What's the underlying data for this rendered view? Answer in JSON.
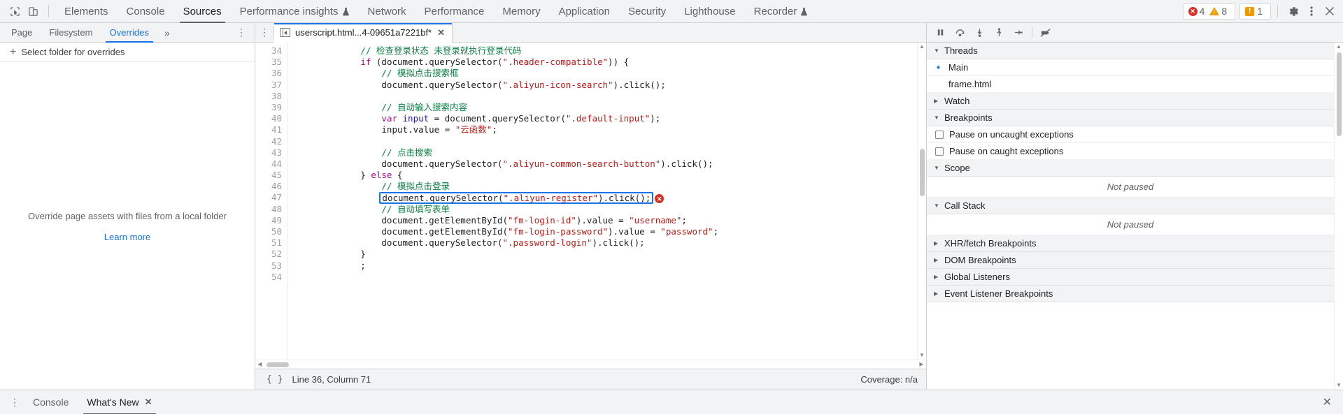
{
  "toolbar": {
    "inspect_icon": "cursor-inspect-icon",
    "device_icon": "device-toolbar-icon",
    "tabs": [
      {
        "label": "Elements",
        "active": false
      },
      {
        "label": "Console",
        "active": false
      },
      {
        "label": "Sources",
        "active": true
      },
      {
        "label": "Performance insights",
        "active": false,
        "badge": "flask-icon"
      },
      {
        "label": "Network",
        "active": false
      },
      {
        "label": "Performance",
        "active": false
      },
      {
        "label": "Memory",
        "active": false
      },
      {
        "label": "Application",
        "active": false
      },
      {
        "label": "Security",
        "active": false
      },
      {
        "label": "Lighthouse",
        "active": false
      },
      {
        "label": "Recorder",
        "active": false,
        "badge": "flask-icon"
      }
    ],
    "error_count": "4",
    "warning_count": "8",
    "issue_count": "1",
    "settings_icon": "gear-icon",
    "more_icon": "vertical-dots-icon",
    "close_icon": "close-icon"
  },
  "navigator": {
    "tabs": [
      {
        "label": "Page",
        "active": false
      },
      {
        "label": "Filesystem",
        "active": false
      },
      {
        "label": "Overrides",
        "active": true
      }
    ],
    "more_tabs": "»",
    "menu_dots": "⋮",
    "select_folder_label": "Select folder for overrides",
    "empty_message": "Override page assets with files from a local folder",
    "learn_more": "Learn more"
  },
  "editor": {
    "tab_dots": "⋮",
    "file_name": "userscript.html...4-09651a7221bf*",
    "close_label": "✕",
    "first_line_number": 34,
    "lines": [
      {
        "n": 34,
        "tokens": [
          {
            "t": "cmt",
            "s": "            // 检查登录状态 未登录就执行登录代码"
          }
        ]
      },
      {
        "n": 35,
        "tokens": [
          {
            "t": "plain",
            "s": "            "
          },
          {
            "t": "kw",
            "s": "if"
          },
          {
            "t": "plain",
            "s": " (document.querySelector("
          },
          {
            "t": "str",
            "s": "\".header-compatible\""
          },
          {
            "t": "plain",
            "s": ")) {"
          }
        ]
      },
      {
        "n": 36,
        "tokens": [
          {
            "t": "cmt",
            "s": "                // 模拟点击搜索框"
          }
        ]
      },
      {
        "n": 37,
        "tokens": [
          {
            "t": "plain",
            "s": "                document.querySelector("
          },
          {
            "t": "str",
            "s": "\".aliyun-icon-search\""
          },
          {
            "t": "plain",
            "s": ").click();"
          }
        ]
      },
      {
        "n": 38,
        "tokens": [
          {
            "t": "plain",
            "s": ""
          }
        ]
      },
      {
        "n": 39,
        "tokens": [
          {
            "t": "cmt",
            "s": "                // 自动输入搜索内容"
          }
        ]
      },
      {
        "n": 40,
        "tokens": [
          {
            "t": "plain",
            "s": "                "
          },
          {
            "t": "kw",
            "s": "var"
          },
          {
            "t": "plain",
            "s": " "
          },
          {
            "t": "var-blue",
            "s": "input"
          },
          {
            "t": "plain",
            "s": " = document.querySelector("
          },
          {
            "t": "str",
            "s": "\".default-input\""
          },
          {
            "t": "plain",
            "s": ");"
          }
        ]
      },
      {
        "n": 41,
        "tokens": [
          {
            "t": "plain",
            "s": "                input.value = "
          },
          {
            "t": "str",
            "s": "\"云函数\""
          },
          {
            "t": "plain",
            "s": ";"
          }
        ]
      },
      {
        "n": 42,
        "tokens": [
          {
            "t": "plain",
            "s": ""
          }
        ]
      },
      {
        "n": 43,
        "tokens": [
          {
            "t": "cmt",
            "s": "                // 点击搜索"
          }
        ]
      },
      {
        "n": 44,
        "tokens": [
          {
            "t": "plain",
            "s": "                document.querySelector("
          },
          {
            "t": "str",
            "s": "\".aliyun-common-search-button\""
          },
          {
            "t": "plain",
            "s": ").click();"
          }
        ]
      },
      {
        "n": 45,
        "tokens": [
          {
            "t": "plain",
            "s": "            } "
          },
          {
            "t": "kw",
            "s": "else"
          },
          {
            "t": "plain",
            "s": " {"
          }
        ]
      },
      {
        "n": 46,
        "tokens": [
          {
            "t": "cmt",
            "s": "                // 模拟点击登录"
          }
        ]
      },
      {
        "n": 47,
        "highlighted": true,
        "error": true,
        "tokens": [
          {
            "t": "plain",
            "s": "                document.querySelector("
          },
          {
            "t": "str",
            "s": "\".aliyun-register\""
          },
          {
            "t": "plain",
            "s": ").click();"
          }
        ]
      },
      {
        "n": 48,
        "tokens": [
          {
            "t": "cmt",
            "s": "                // 自动填写表单"
          }
        ]
      },
      {
        "n": 49,
        "tokens": [
          {
            "t": "plain",
            "s": "                document.getElementById("
          },
          {
            "t": "str",
            "s": "\"fm-login-id\""
          },
          {
            "t": "plain",
            "s": ").value = "
          },
          {
            "t": "str",
            "s": "\"username\""
          },
          {
            "t": "plain",
            "s": ";"
          }
        ]
      },
      {
        "n": 50,
        "tokens": [
          {
            "t": "plain",
            "s": "                document.getElementById("
          },
          {
            "t": "str",
            "s": "\"fm-login-password\""
          },
          {
            "t": "plain",
            "s": ").value = "
          },
          {
            "t": "str",
            "s": "\"password\""
          },
          {
            "t": "plain",
            "s": ";"
          }
        ]
      },
      {
        "n": 51,
        "tokens": [
          {
            "t": "plain",
            "s": "                document.querySelector("
          },
          {
            "t": "str",
            "s": "\".password-login\""
          },
          {
            "t": "plain",
            "s": ").click();"
          }
        ]
      },
      {
        "n": 52,
        "tokens": [
          {
            "t": "plain",
            "s": "            }"
          }
        ]
      },
      {
        "n": 53,
        "tokens": [
          {
            "t": "plain",
            "s": "            ;"
          }
        ]
      },
      {
        "n": 54,
        "tokens": [
          {
            "t": "plain",
            "s": ""
          }
        ]
      }
    ],
    "error_badge": "✕",
    "status": {
      "format_icon": "{ }",
      "cursor_position": "Line 36, Column 71",
      "coverage": "Coverage: n/a"
    }
  },
  "debugger": {
    "toolbar_buttons": [
      {
        "name": "pause-script-button",
        "icon": "pause-icon"
      },
      {
        "name": "step-over-button",
        "icon": "step-over-icon"
      },
      {
        "name": "step-into-button",
        "icon": "step-into-icon"
      },
      {
        "name": "step-out-button",
        "icon": "step-out-icon"
      },
      {
        "name": "step-button",
        "icon": "step-icon"
      },
      {
        "name": "deactivate-breakpoints-button",
        "icon": "deactivate-breakpoints-icon"
      }
    ],
    "sections": [
      {
        "name": "threads",
        "title": "Threads",
        "expanded": true,
        "rows": [
          {
            "label": "Main",
            "selected": true
          },
          {
            "label": "frame.html",
            "selected": false
          }
        ]
      },
      {
        "name": "watch",
        "title": "Watch",
        "expanded": false,
        "rows": []
      },
      {
        "name": "breakpoints",
        "title": "Breakpoints",
        "expanded": true,
        "checkboxes": [
          {
            "label": "Pause on uncaught exceptions",
            "checked": false
          },
          {
            "label": "Pause on caught exceptions",
            "checked": false
          }
        ]
      },
      {
        "name": "scope",
        "title": "Scope",
        "expanded": true,
        "empty_text": "Not paused"
      },
      {
        "name": "call-stack",
        "title": "Call Stack",
        "expanded": true,
        "empty_text": "Not paused"
      },
      {
        "name": "xhr-fetch-breakpoints",
        "title": "XHR/fetch Breakpoints",
        "expanded": false
      },
      {
        "name": "dom-breakpoints",
        "title": "DOM Breakpoints",
        "expanded": false
      },
      {
        "name": "global-listeners",
        "title": "Global Listeners",
        "expanded": false
      },
      {
        "name": "event-listener-breakpoints",
        "title": "Event Listener Breakpoints",
        "expanded": false
      }
    ]
  },
  "drawer": {
    "menu_dots": "⋮",
    "tabs": [
      {
        "label": "Console",
        "active": false,
        "closable": false
      },
      {
        "label": "What's New",
        "active": true,
        "closable": true
      }
    ],
    "close_label": "✕",
    "drawer_close": "✕"
  }
}
